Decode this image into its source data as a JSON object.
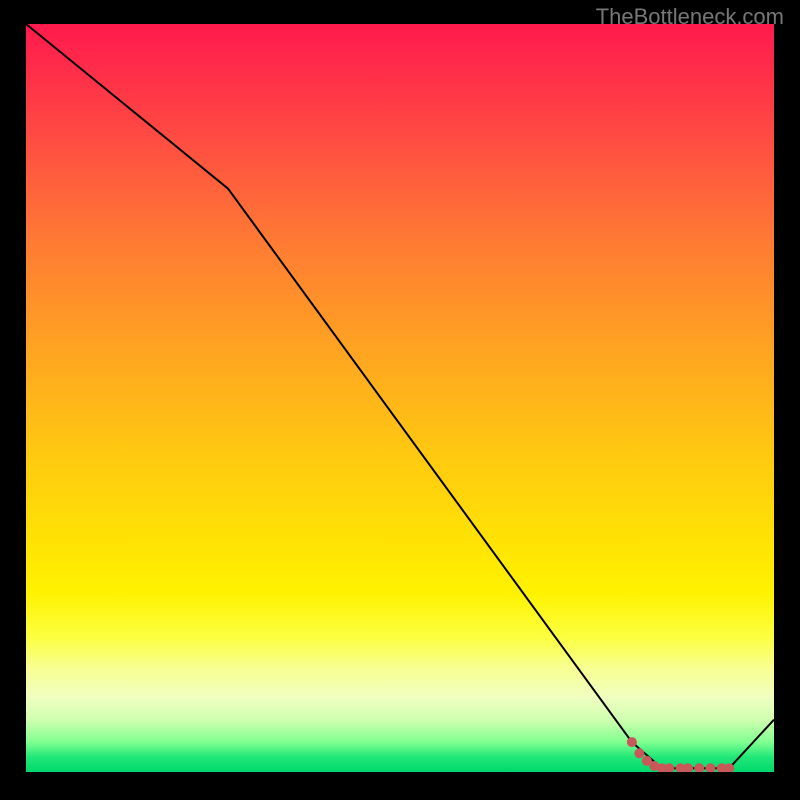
{
  "watermark": "TheBottleneck.com",
  "chart_data": {
    "type": "line",
    "title": "",
    "xlabel": "",
    "ylabel": "",
    "xlim": [
      0,
      100
    ],
    "ylim": [
      0,
      100
    ],
    "series": [
      {
        "name": "main-line",
        "x": [
          0,
          27,
          81,
          85,
          94,
          100
        ],
        "y": [
          100,
          78,
          4,
          0.5,
          0.5,
          7
        ],
        "color": "#000000"
      }
    ],
    "markers": {
      "name": "highlight-points",
      "color": "#c95858",
      "points": [
        {
          "x": 81,
          "y": 4
        },
        {
          "x": 82,
          "y": 2.5
        },
        {
          "x": 83,
          "y": 1.5
        },
        {
          "x": 84,
          "y": 0.8
        },
        {
          "x": 85,
          "y": 0.5
        },
        {
          "x": 86,
          "y": 0.5
        },
        {
          "x": 87.5,
          "y": 0.5
        },
        {
          "x": 88.5,
          "y": 0.5
        },
        {
          "x": 90,
          "y": 0.5
        },
        {
          "x": 91.5,
          "y": 0.5
        },
        {
          "x": 93,
          "y": 0.5
        },
        {
          "x": 94,
          "y": 0.5
        }
      ]
    }
  }
}
